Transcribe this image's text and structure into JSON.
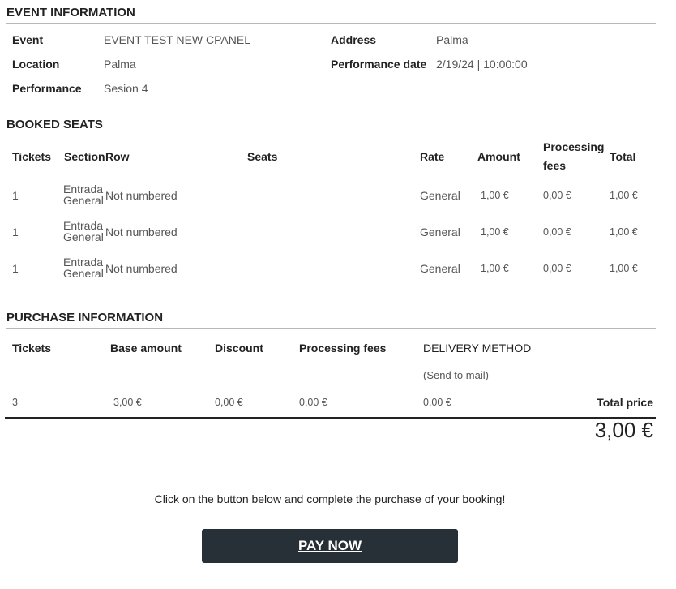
{
  "event_info": {
    "title": "EVENT INFORMATION",
    "event_label": "Event",
    "event_value": "EVENT TEST NEW CPANEL",
    "address_label": "Address",
    "address_value": "Palma",
    "location_label": "Location",
    "location_value": "Palma",
    "perf_date_label": "Performance date",
    "perf_date_value": "2/19/24 | 10:00:00",
    "performance_label": "Performance",
    "performance_value": "Sesion 4"
  },
  "booked_seats": {
    "title": "BOOKED SEATS",
    "headers": {
      "tickets": "Tickets",
      "section": "Section",
      "row": "Row",
      "seats": "Seats",
      "rate": "Rate",
      "amount": "Amount",
      "processing_1": "Processing",
      "processing_2": "fees",
      "total": "Total"
    },
    "rows": [
      {
        "tickets": "1",
        "section_1": "Entrada",
        "section_2": "General",
        "row": "Not numbered",
        "rate": "General",
        "amount": "1,00 €",
        "fees": "0,00 €",
        "total": "1,00 €"
      },
      {
        "tickets": "1",
        "section_1": "Entrada",
        "section_2": "General",
        "row": "Not numbered",
        "rate": "General",
        "amount": "1,00 €",
        "fees": "0,00 €",
        "total": "1,00 €"
      },
      {
        "tickets": "1",
        "section_1": "Entrada",
        "section_2": "General",
        "row": "Not numbered",
        "rate": "General",
        "amount": "1,00 €",
        "fees": "0,00 €",
        "total": "1,00 €"
      }
    ]
  },
  "purchase": {
    "title": "PURCHASE INFORMATION",
    "headers": {
      "tickets": "Tickets",
      "base_amount": "Base amount",
      "discount": "Discount",
      "processing_fees": "Processing fees",
      "delivery_method": "DELIVERY METHOD",
      "delivery_note": "(Send to mail)"
    },
    "values": {
      "tickets": "3",
      "base_amount": "3,00 €",
      "discount": "0,00 €",
      "processing_fees": "0,00 €",
      "delivery": "0,00 €"
    },
    "total_label": "Total price",
    "total_value": "3,00 €"
  },
  "cta_text": "Click on the button below and complete the purchase of your booking!",
  "pay_button": "PAY NOW"
}
